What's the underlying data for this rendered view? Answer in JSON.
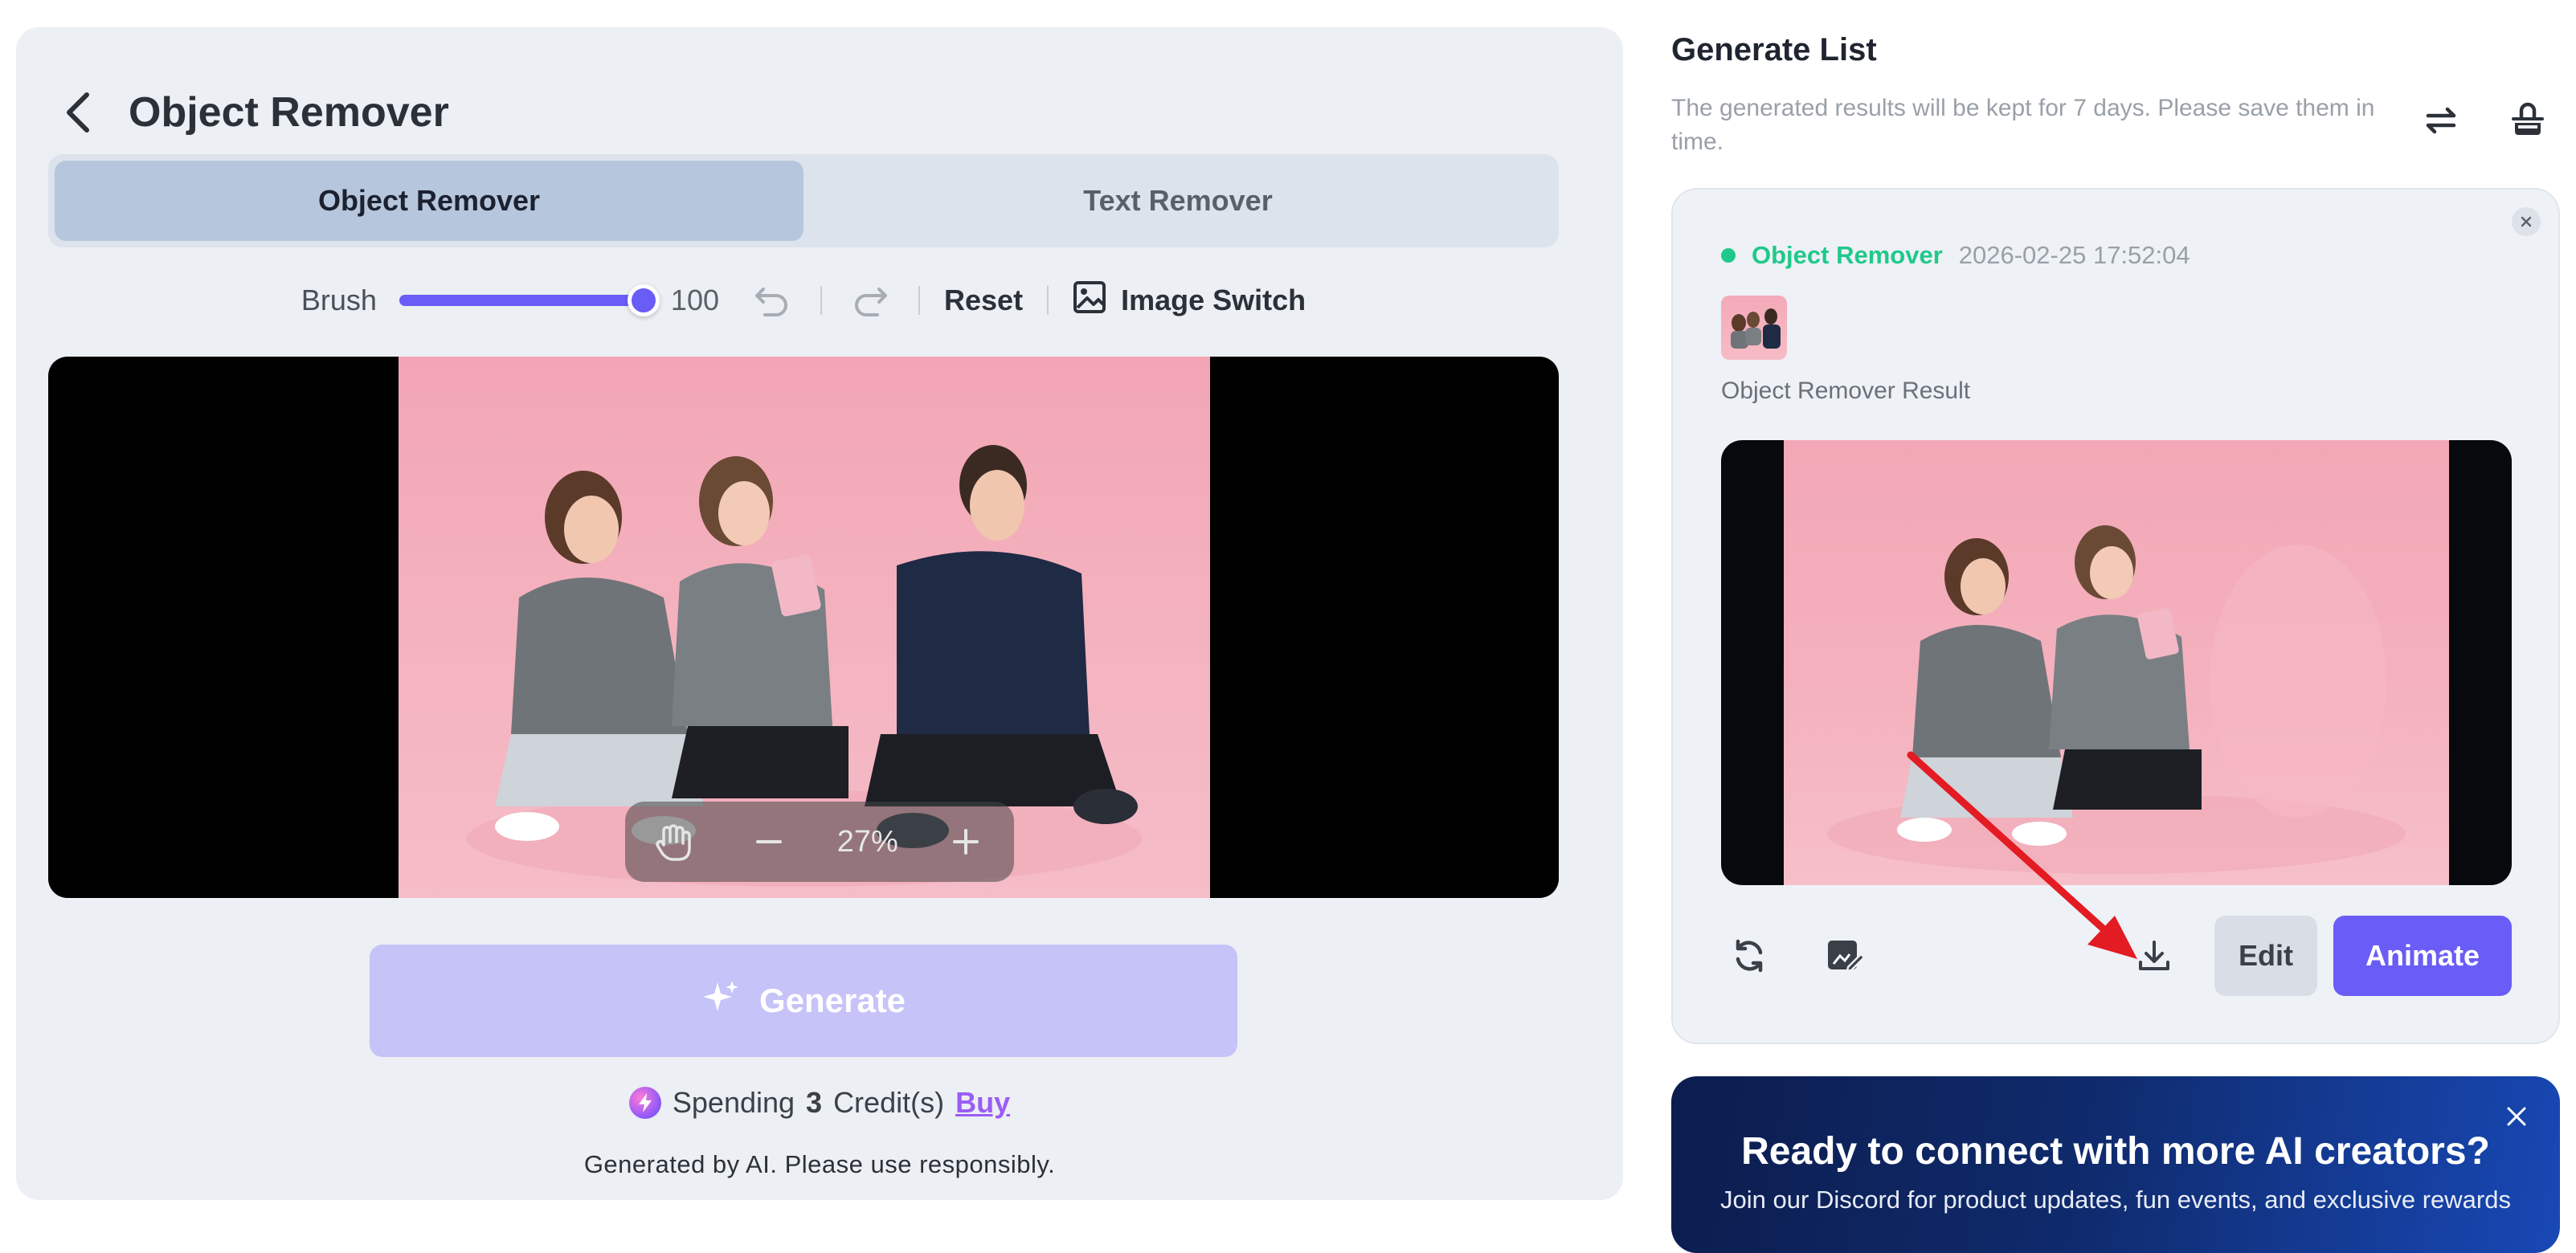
{
  "header": {
    "title": "Object Remover"
  },
  "tabs": [
    {
      "label": "Object Remover",
      "active": true
    },
    {
      "label": "Text Remover",
      "active": false
    }
  ],
  "toolbar": {
    "brush_label": "Brush",
    "brush_value": "100",
    "reset_label": "Reset",
    "image_switch_label": "Image Switch"
  },
  "canvas": {
    "zoom_level": "27%"
  },
  "generate": {
    "label": "Generate"
  },
  "spending": {
    "prefix": "Spending",
    "amount": "3",
    "suffix": "Credit(s)",
    "buy_label": "Buy"
  },
  "disclaimer": "Generated by AI. Please use responsibly.",
  "right_panel": {
    "title": "Generate List",
    "subtitle": "The generated results will be kept for 7 days. Please save them in time."
  },
  "card": {
    "tool_name": "Object Remover",
    "timestamp": "2026-02-25 17:52:04",
    "result_label": "Object Remover Result",
    "edit_label": "Edit",
    "animate_label": "Animate"
  },
  "promo": {
    "title": "Ready to connect with more AI creators?",
    "subtitle": "Join our Discord for product updates, fun events, and exclusive rewards"
  },
  "colors": {
    "accent": "#6a5cf6",
    "status_green": "#1fc98a",
    "generate_disabled": "#c5c3f7",
    "arrow_red": "#e31b23"
  },
  "icons": {
    "back": "chevron-left-icon",
    "undo": "undo-icon",
    "redo": "redo-icon",
    "image_switch": "image-icon",
    "hand": "hand-icon",
    "zoom_out": "minus-icon",
    "zoom_in": "plus-icon",
    "sparkle": "sparkle-icon",
    "refresh": "refresh-icon",
    "clear": "clear-list-icon",
    "regenerate": "regenerate-icon",
    "edit_image": "edit-image-icon",
    "download": "download-icon"
  }
}
